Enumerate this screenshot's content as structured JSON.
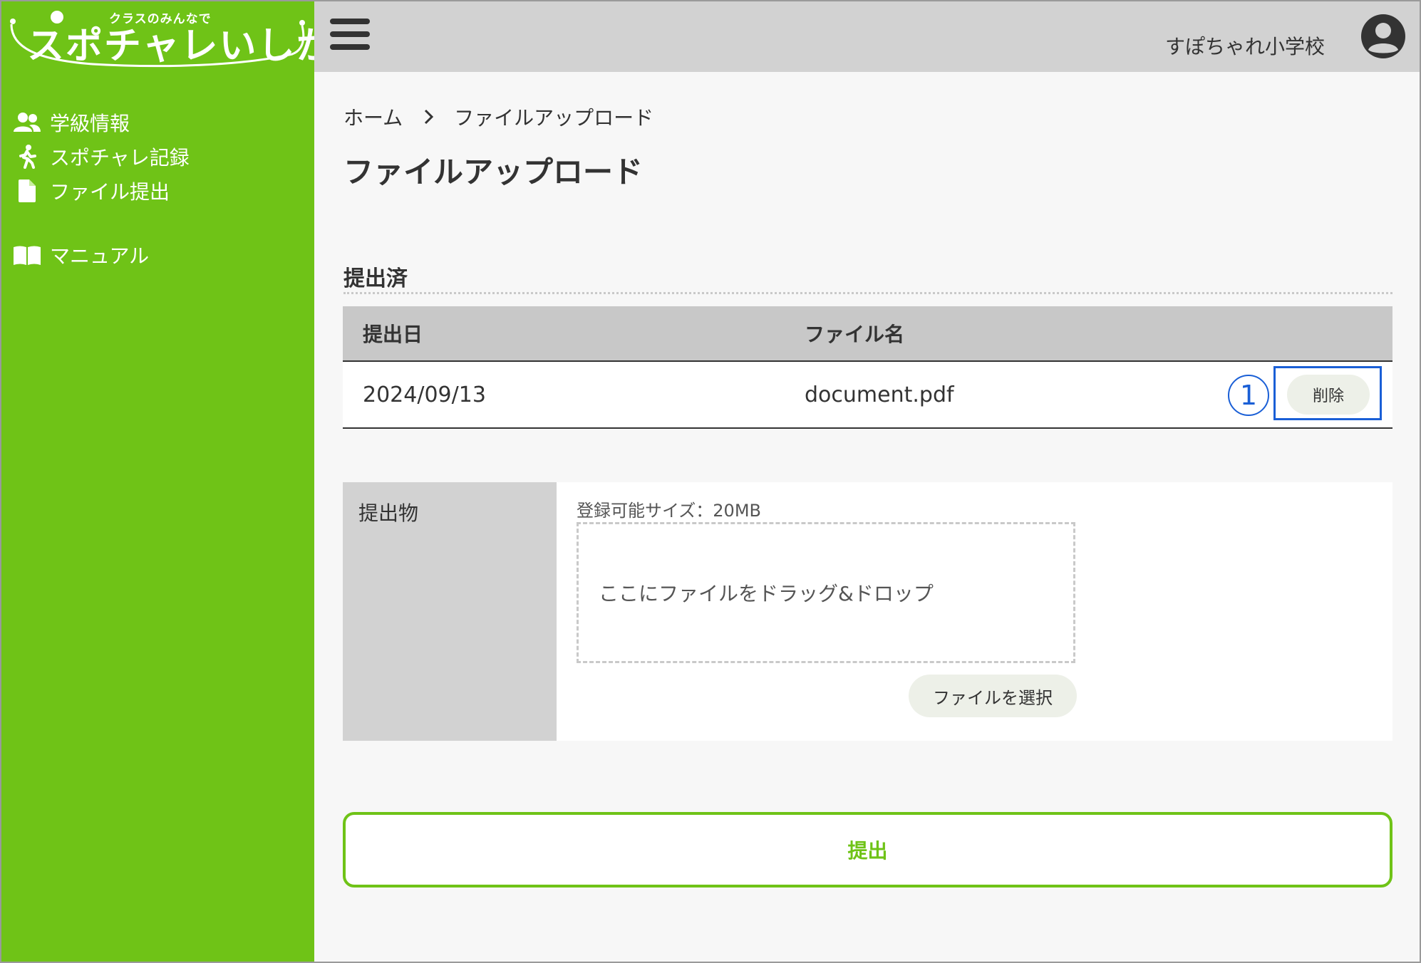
{
  "logo": {
    "sub": "クラスのみんなで",
    "main": "スポチャレいしかわ"
  },
  "sidebar": {
    "items": [
      {
        "label": "学級情報",
        "icon": "users-icon"
      },
      {
        "label": "スポチャレ記録",
        "icon": "running-icon"
      },
      {
        "label": "ファイル提出",
        "icon": "file-icon"
      },
      {
        "label": "マニュアル",
        "icon": "book-icon"
      }
    ]
  },
  "header": {
    "school_name": "すぽちゃれ小学校"
  },
  "breadcrumb": {
    "home": "ホーム",
    "current": "ファイルアップロード"
  },
  "page": {
    "title": "ファイルアップロード"
  },
  "submitted": {
    "title": "提出済",
    "columns": [
      "提出日",
      "ファイル名"
    ],
    "rows": [
      {
        "date": "2024/09/13",
        "filename": "document.pdf",
        "delete_label": "削除"
      }
    ],
    "callout_number": "1"
  },
  "upload": {
    "label": "提出物",
    "size_note": "登録可能サイズ：20MB",
    "dropzone_text": "ここにファイルをドラッグ&ドロップ",
    "select_label": "ファイルを選択"
  },
  "submit": {
    "label": "提出"
  },
  "colors": {
    "brand_green": "#6fc317",
    "callout_blue": "#1a5fd6",
    "header_gray": "#d2d2d2"
  }
}
